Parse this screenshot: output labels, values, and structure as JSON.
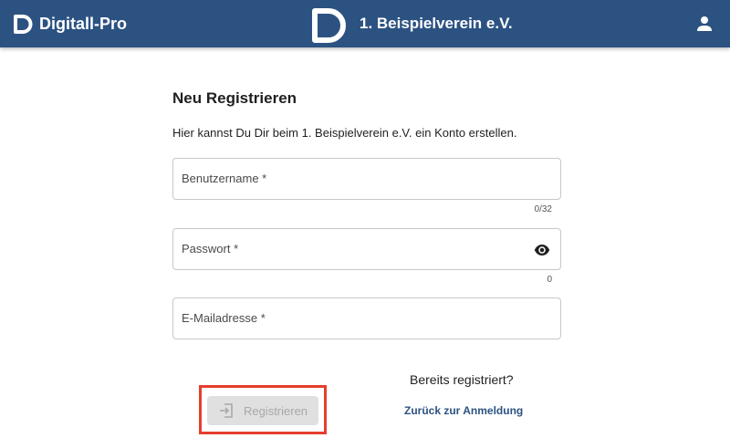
{
  "header": {
    "brand_name": "Digitall-Pro",
    "club_name": "1. Beispielverein e.V.",
    "user_icon": "account-icon",
    "bar_color": "#2c5282"
  },
  "form": {
    "title": "Neu Registrieren",
    "intro": "Hier kannst Du Dir beim 1. Beispielverein e.V. ein Konto erstellen.",
    "username": {
      "label": "Benutzername *",
      "value": "",
      "counter": "0/32"
    },
    "password": {
      "label": "Passwort *",
      "value": "",
      "counter": "0",
      "toggle_icon": "eye-icon"
    },
    "email": {
      "label": "E-Mailadresse *",
      "value": ""
    },
    "register_button": {
      "label": "Registrieren",
      "icon": "login-icon",
      "disabled": true
    },
    "highlight_color": "#e53e2e"
  },
  "login_prompt": {
    "question": "Bereits registriert?",
    "link": "Zurück zur Anmeldung"
  }
}
